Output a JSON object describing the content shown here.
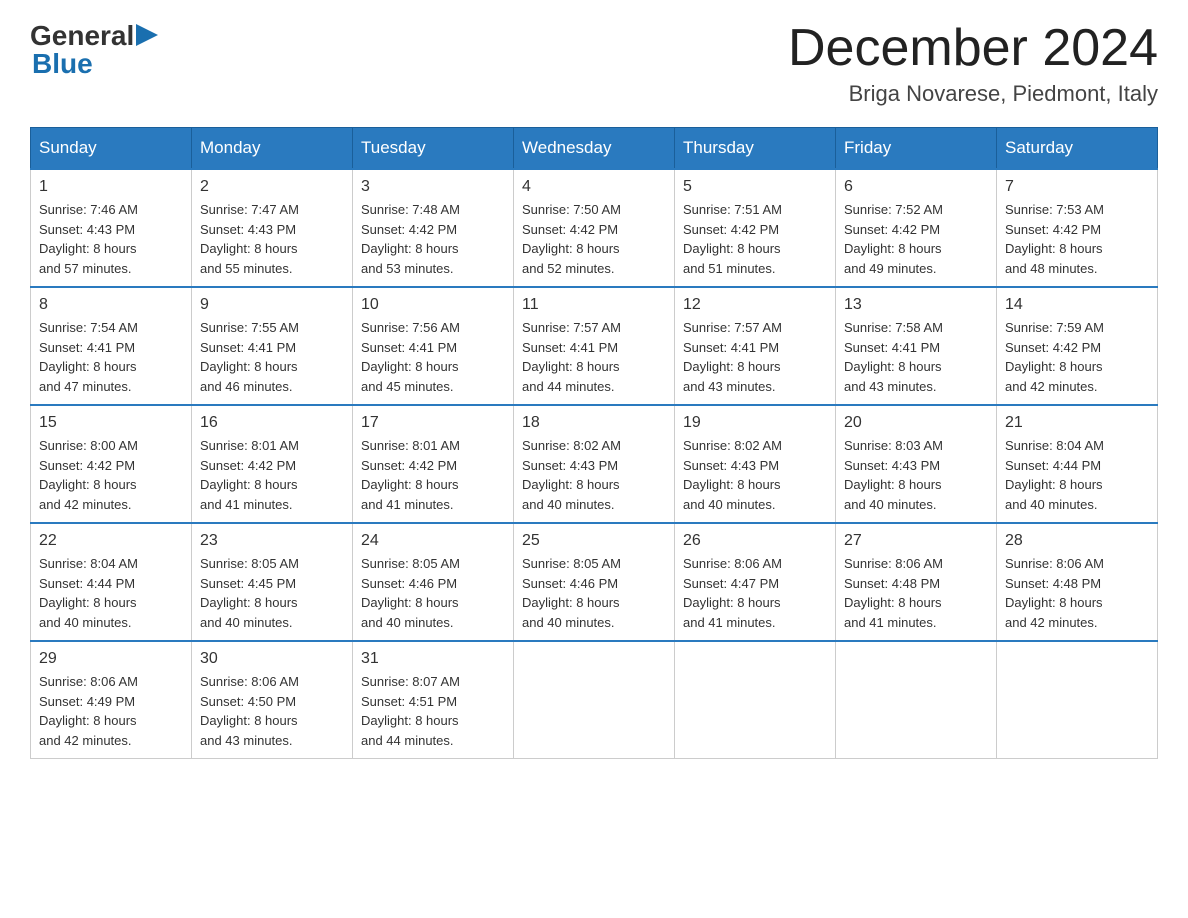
{
  "logo": {
    "general": "General",
    "blue": "Blue",
    "arrow": "▶"
  },
  "header": {
    "month_title": "December 2024",
    "location": "Briga Novarese, Piedmont, Italy"
  },
  "days_of_week": [
    "Sunday",
    "Monday",
    "Tuesday",
    "Wednesday",
    "Thursday",
    "Friday",
    "Saturday"
  ],
  "weeks": [
    [
      {
        "day": "1",
        "sunrise": "7:46 AM",
        "sunset": "4:43 PM",
        "daylight": "8 hours and 57 minutes."
      },
      {
        "day": "2",
        "sunrise": "7:47 AM",
        "sunset": "4:43 PM",
        "daylight": "8 hours and 55 minutes."
      },
      {
        "day": "3",
        "sunrise": "7:48 AM",
        "sunset": "4:42 PM",
        "daylight": "8 hours and 53 minutes."
      },
      {
        "day": "4",
        "sunrise": "7:50 AM",
        "sunset": "4:42 PM",
        "daylight": "8 hours and 52 minutes."
      },
      {
        "day": "5",
        "sunrise": "7:51 AM",
        "sunset": "4:42 PM",
        "daylight": "8 hours and 51 minutes."
      },
      {
        "day": "6",
        "sunrise": "7:52 AM",
        "sunset": "4:42 PM",
        "daylight": "8 hours and 49 minutes."
      },
      {
        "day": "7",
        "sunrise": "7:53 AM",
        "sunset": "4:42 PM",
        "daylight": "8 hours and 48 minutes."
      }
    ],
    [
      {
        "day": "8",
        "sunrise": "7:54 AM",
        "sunset": "4:41 PM",
        "daylight": "8 hours and 47 minutes."
      },
      {
        "day": "9",
        "sunrise": "7:55 AM",
        "sunset": "4:41 PM",
        "daylight": "8 hours and 46 minutes."
      },
      {
        "day": "10",
        "sunrise": "7:56 AM",
        "sunset": "4:41 PM",
        "daylight": "8 hours and 45 minutes."
      },
      {
        "day": "11",
        "sunrise": "7:57 AM",
        "sunset": "4:41 PM",
        "daylight": "8 hours and 44 minutes."
      },
      {
        "day": "12",
        "sunrise": "7:57 AM",
        "sunset": "4:41 PM",
        "daylight": "8 hours and 43 minutes."
      },
      {
        "day": "13",
        "sunrise": "7:58 AM",
        "sunset": "4:41 PM",
        "daylight": "8 hours and 43 minutes."
      },
      {
        "day": "14",
        "sunrise": "7:59 AM",
        "sunset": "4:42 PM",
        "daylight": "8 hours and 42 minutes."
      }
    ],
    [
      {
        "day": "15",
        "sunrise": "8:00 AM",
        "sunset": "4:42 PM",
        "daylight": "8 hours and 42 minutes."
      },
      {
        "day": "16",
        "sunrise": "8:01 AM",
        "sunset": "4:42 PM",
        "daylight": "8 hours and 41 minutes."
      },
      {
        "day": "17",
        "sunrise": "8:01 AM",
        "sunset": "4:42 PM",
        "daylight": "8 hours and 41 minutes."
      },
      {
        "day": "18",
        "sunrise": "8:02 AM",
        "sunset": "4:43 PM",
        "daylight": "8 hours and 40 minutes."
      },
      {
        "day": "19",
        "sunrise": "8:02 AM",
        "sunset": "4:43 PM",
        "daylight": "8 hours and 40 minutes."
      },
      {
        "day": "20",
        "sunrise": "8:03 AM",
        "sunset": "4:43 PM",
        "daylight": "8 hours and 40 minutes."
      },
      {
        "day": "21",
        "sunrise": "8:04 AM",
        "sunset": "4:44 PM",
        "daylight": "8 hours and 40 minutes."
      }
    ],
    [
      {
        "day": "22",
        "sunrise": "8:04 AM",
        "sunset": "4:44 PM",
        "daylight": "8 hours and 40 minutes."
      },
      {
        "day": "23",
        "sunrise": "8:05 AM",
        "sunset": "4:45 PM",
        "daylight": "8 hours and 40 minutes."
      },
      {
        "day": "24",
        "sunrise": "8:05 AM",
        "sunset": "4:46 PM",
        "daylight": "8 hours and 40 minutes."
      },
      {
        "day": "25",
        "sunrise": "8:05 AM",
        "sunset": "4:46 PM",
        "daylight": "8 hours and 40 minutes."
      },
      {
        "day": "26",
        "sunrise": "8:06 AM",
        "sunset": "4:47 PM",
        "daylight": "8 hours and 41 minutes."
      },
      {
        "day": "27",
        "sunrise": "8:06 AM",
        "sunset": "4:48 PM",
        "daylight": "8 hours and 41 minutes."
      },
      {
        "day": "28",
        "sunrise": "8:06 AM",
        "sunset": "4:48 PM",
        "daylight": "8 hours and 42 minutes."
      }
    ],
    [
      {
        "day": "29",
        "sunrise": "8:06 AM",
        "sunset": "4:49 PM",
        "daylight": "8 hours and 42 minutes."
      },
      {
        "day": "30",
        "sunrise": "8:06 AM",
        "sunset": "4:50 PM",
        "daylight": "8 hours and 43 minutes."
      },
      {
        "day": "31",
        "sunrise": "8:07 AM",
        "sunset": "4:51 PM",
        "daylight": "8 hours and 44 minutes."
      },
      null,
      null,
      null,
      null
    ]
  ]
}
